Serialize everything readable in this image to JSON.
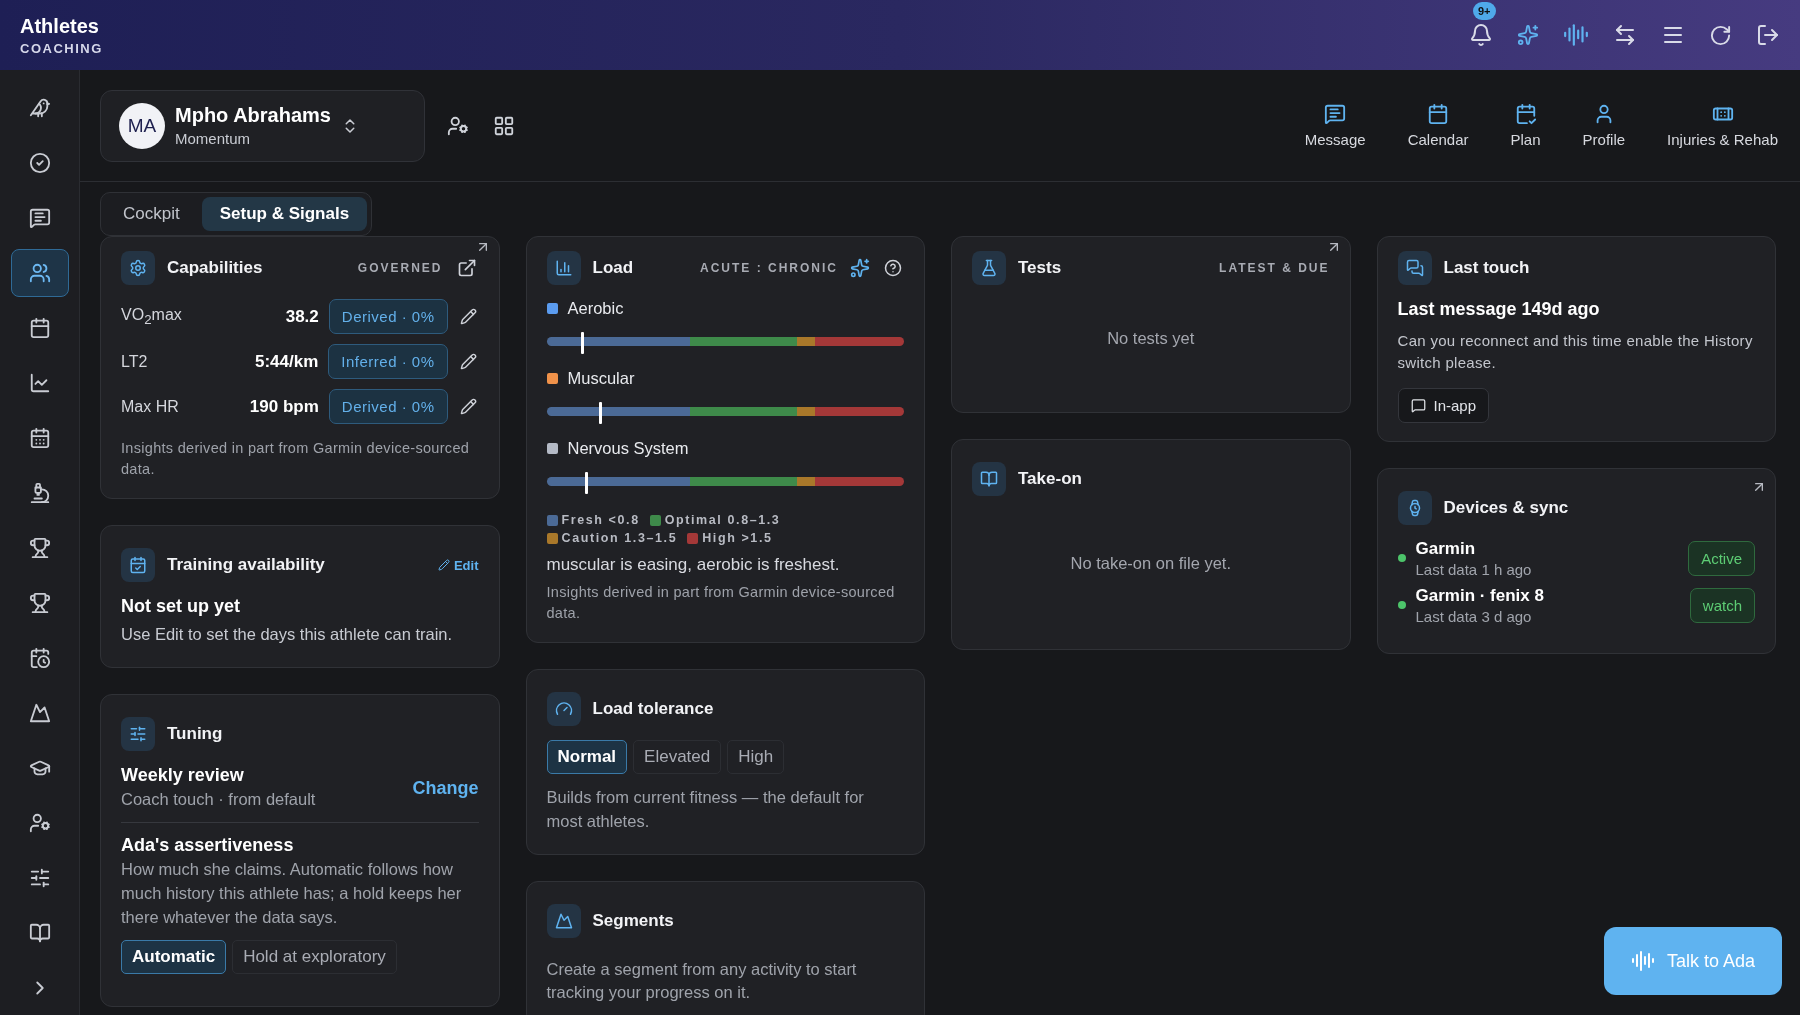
{
  "app": {
    "title": "Athletes",
    "subtitle": "COACHING"
  },
  "header": {
    "notification_count": "9+"
  },
  "sidebar": {
    "items": [
      {
        "selected": false
      },
      {
        "selected": false
      },
      {
        "selected": false
      },
      {
        "selected": true
      },
      {
        "selected": false
      },
      {
        "selected": false
      },
      {
        "selected": false
      },
      {
        "selected": false
      },
      {
        "selected": false
      },
      {
        "selected": false
      },
      {
        "selected": false
      },
      {
        "selected": false
      },
      {
        "selected": false
      },
      {
        "selected": false
      },
      {
        "selected": false
      },
      {
        "selected": false
      }
    ]
  },
  "athlete": {
    "initials": "MA",
    "name": "Mpho Abrahams",
    "group": "Momentum"
  },
  "actions": [
    {
      "label": "Message"
    },
    {
      "label": "Calendar"
    },
    {
      "label": "Plan"
    },
    {
      "label": "Profile"
    },
    {
      "label": "Injuries & Rehab"
    }
  ],
  "tabs": [
    {
      "label": "Cockpit",
      "selected": false
    },
    {
      "label": "Setup & Signals",
      "selected": true
    }
  ],
  "capabilities": {
    "title": "Capabilities",
    "tag": "GOVERNED",
    "rows": [
      {
        "label": "VO$_{2}$max",
        "value": "38.2",
        "source": "Derived · 0%"
      },
      {
        "label": "LT2",
        "value": "5:44/km",
        "source": "Inferred · 0%"
      },
      {
        "label": "Max HR",
        "value": "190 bpm",
        "source": "Derived · 0%"
      }
    ],
    "note": "Insights derived in part from Garmin device-sourced data."
  },
  "training_availability": {
    "title": "Training availability",
    "edit": "Edit",
    "status": "Not set up yet",
    "description": "Use Edit to set the days this athlete can train."
  },
  "tuning": {
    "title": "Tuning",
    "review_title": "Weekly review",
    "review_detail": "Coach touch · from default",
    "change": "Change",
    "assertiveness_title": "Ada's assertiveness",
    "assertiveness_description": "How much she claims. Automatic follows how much history this athlete has; a hold keeps her there whatever the data says.",
    "options": [
      {
        "label": "Automatic",
        "selected": true
      },
      {
        "label": "Hold at exploratory",
        "selected": false
      }
    ]
  },
  "load": {
    "title": "Load",
    "tag": "ACUTE : CHRONIC",
    "rows": [
      {
        "name": "Aerobic",
        "color": "#5b9cf0",
        "level": 0.1
      },
      {
        "name": "Muscular",
        "color": "#f0924a",
        "level": 0.15
      },
      {
        "name": "Nervous System",
        "color": "#b4bac6",
        "level": 0.11
      }
    ],
    "legend": [
      {
        "label": "Fresh <0.8",
        "color": "#4b6a96"
      },
      {
        "label": "Optimal 0.8–1.3",
        "color": "#3e8a4a"
      },
      {
        "label": "Caution 1.3–1.5",
        "color": "#a9782a"
      },
      {
        "label": "High >1.5",
        "color": "#a43838"
      }
    ],
    "summary": "muscular is easing, aerobic is freshest.",
    "note": "Insights derived in part from Garmin device-sourced data."
  },
  "load_tolerance": {
    "title": "Load tolerance",
    "options": [
      {
        "label": "Normal",
        "selected": true
      },
      {
        "label": "Elevated",
        "selected": false
      },
      {
        "label": "High",
        "selected": false
      }
    ],
    "description": "Builds from current fitness — the default for most athletes."
  },
  "segments": {
    "title": "Segments",
    "description": "Create a segment from any activity to start tracking your progress on it."
  },
  "tests": {
    "title": "Tests",
    "tag": "LATEST & DUE",
    "empty": "No tests yet"
  },
  "take_on": {
    "title": "Take-on",
    "empty": "No take-on on file yet."
  },
  "last_touch": {
    "title": "Last touch",
    "headline": "Last message 149d ago",
    "message": "Can you reconnect and this time enable the History switch please.",
    "channel": "In-app"
  },
  "devices": {
    "title": "Devices & sync",
    "items": [
      {
        "name": "Garmin",
        "detail": "Last data 1 h ago",
        "status": "Active",
        "color": "#4cc46a"
      },
      {
        "name": "Garmin · fenix 8",
        "detail": "Last data 3 d ago",
        "status": "watch",
        "color": "#4cc46a"
      }
    ]
  },
  "assistant": {
    "label": "Talk to Ada"
  }
}
